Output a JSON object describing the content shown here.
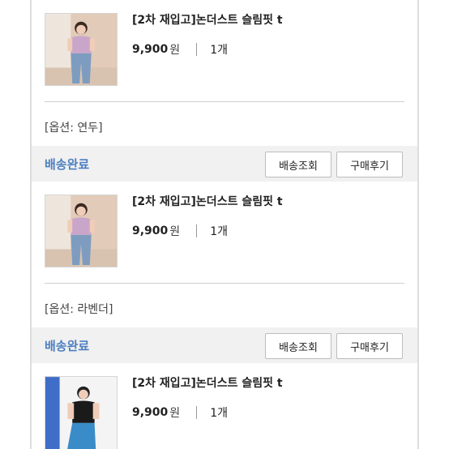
{
  "orders": [
    {
      "product_name": "[2차 재입고]논더스트 슬림핏 t",
      "price": "9,900",
      "currency": "원",
      "quantity": "1개",
      "option": "[옵션: 연두]",
      "status": "배송완료",
      "track_label": "배송조회",
      "review_label": "구매후기"
    },
    {
      "product_name": "[2차 재입고]논더스트 슬림핏 t",
      "price": "9,900",
      "currency": "원",
      "quantity": "1개",
      "option": "[옵션: 라벤더]",
      "status": "배송완료",
      "track_label": "배송조회",
      "review_label": "구매후기"
    },
    {
      "product_name": "[2차 재입고]논더스트 슬림핏 t",
      "price": "9,900",
      "currency": "원",
      "quantity": "1개"
    }
  ],
  "colors": {
    "status_blue": "#4d7fc0",
    "status_bar_bg": "#f1f1f1",
    "lavender_top": "#c9a6c9",
    "black_top": "#1a1a1a",
    "jeans": "#7e9cc0"
  }
}
